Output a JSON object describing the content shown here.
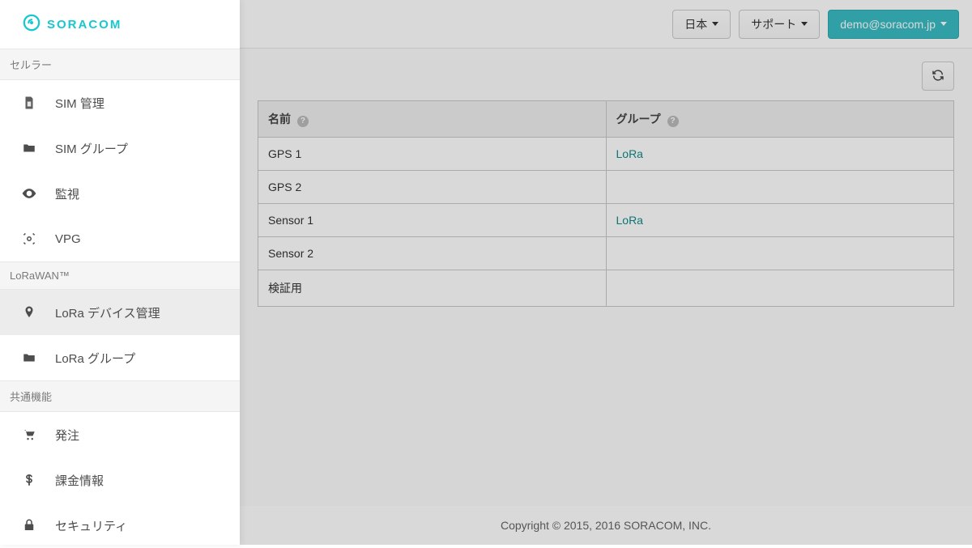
{
  "brand": {
    "name": "SORACOM"
  },
  "topbar": {
    "lang_label": "日本",
    "support_label": "サポート",
    "account_label": "demo@soracom.jp"
  },
  "sidebar": {
    "sections": [
      {
        "title": "セルラー",
        "items": [
          {
            "label": "SIM 管理",
            "icon": "sim-icon"
          },
          {
            "label": "SIM グループ",
            "icon": "folder-icon"
          },
          {
            "label": "監視",
            "icon": "eye-icon"
          },
          {
            "label": "VPG",
            "icon": "vpg-icon"
          }
        ]
      },
      {
        "title": "LoRaWAN™",
        "items": [
          {
            "label": "LoRa デバイス管理",
            "icon": "pin-icon",
            "active": true
          },
          {
            "label": "LoRa グループ",
            "icon": "folder-icon"
          }
        ]
      },
      {
        "title": "共通機能",
        "items": [
          {
            "label": "発注",
            "icon": "cart-icon"
          },
          {
            "label": "課金情報",
            "icon": "dollar-icon"
          },
          {
            "label": "セキュリティ",
            "icon": "lock-icon"
          }
        ]
      }
    ]
  },
  "table": {
    "columns": {
      "name": "名前",
      "group": "グループ"
    },
    "rows": [
      {
        "name": "GPS 1",
        "group": "LoRa"
      },
      {
        "name": "GPS 2",
        "group": ""
      },
      {
        "name": "Sensor 1",
        "group": "LoRa"
      },
      {
        "name": "Sensor 2",
        "group": ""
      },
      {
        "name": "検証用",
        "group": ""
      }
    ]
  },
  "footer": {
    "copyright": "Copyright © 2015, 2016 SORACOM, INC."
  }
}
